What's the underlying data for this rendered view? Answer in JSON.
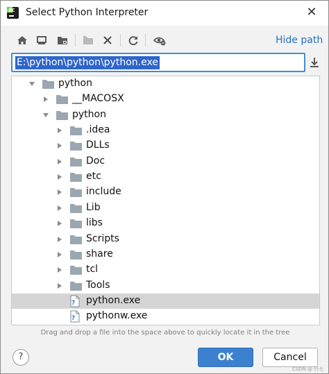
{
  "window": {
    "title": "Select Python Interpreter",
    "app_icon": "pycharm-icon",
    "close_icon": "close-icon"
  },
  "toolbar": {
    "buttons": [
      {
        "icon": "home-icon"
      },
      {
        "icon": "desktop-icon"
      },
      {
        "icon": "project-folder-icon"
      },
      {
        "icon": "new-folder-icon"
      },
      {
        "icon": "delete-icon"
      },
      {
        "icon": "refresh-icon"
      },
      {
        "icon": "show-hidden-icon"
      }
    ],
    "hide_path_label": "Hide path"
  },
  "path": {
    "value": "E:\\python\\python\\python.exe",
    "download_icon": "download-icon"
  },
  "tree": {
    "rows": [
      {
        "label": "python",
        "type": "folder",
        "level": 0,
        "expanded": true
      },
      {
        "label": "__MACOSX",
        "type": "folder",
        "level": 1,
        "expanded": false
      },
      {
        "label": "python",
        "type": "folder",
        "level": 1,
        "expanded": true
      },
      {
        "label": ".idea",
        "type": "folder",
        "level": 2,
        "expanded": false
      },
      {
        "label": "DLLs",
        "type": "folder",
        "level": 2,
        "expanded": false
      },
      {
        "label": "Doc",
        "type": "folder",
        "level": 2,
        "expanded": false
      },
      {
        "label": "etc",
        "type": "folder",
        "level": 2,
        "expanded": false
      },
      {
        "label": "include",
        "type": "folder",
        "level": 2,
        "expanded": false
      },
      {
        "label": "Lib",
        "type": "folder",
        "level": 2,
        "expanded": false
      },
      {
        "label": "libs",
        "type": "folder",
        "level": 2,
        "expanded": false
      },
      {
        "label": "Scripts",
        "type": "folder",
        "level": 2,
        "expanded": false
      },
      {
        "label": "share",
        "type": "folder",
        "level": 2,
        "expanded": false
      },
      {
        "label": "tcl",
        "type": "folder",
        "level": 2,
        "expanded": false
      },
      {
        "label": "Tools",
        "type": "folder",
        "level": 2,
        "expanded": false
      },
      {
        "label": "python.exe",
        "type": "file",
        "level": 2,
        "selected": true
      },
      {
        "label": "pythonw.exe",
        "type": "file",
        "level": 2
      }
    ]
  },
  "hint": "Drag and drop a file into the space above to quickly locate it in the tree",
  "buttons": {
    "help_label": "?",
    "ok_label": "OK",
    "cancel_label": "Cancel"
  },
  "watermark": "CSDN @ 行七",
  "colors": {
    "accent": "#3c81cf",
    "link": "#2470c2",
    "selection": "#2f65ca",
    "row_selected": "#d5d5d5",
    "folder": "#9aa7b0"
  }
}
